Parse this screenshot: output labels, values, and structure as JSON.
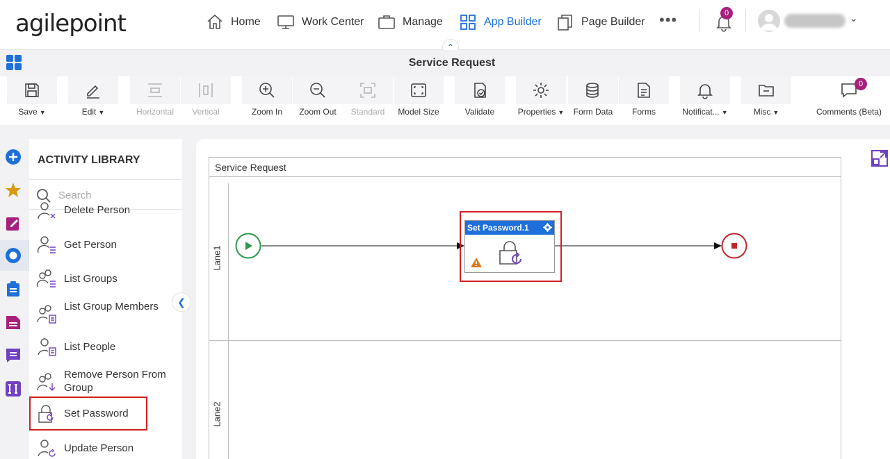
{
  "nav": {
    "logo": "agilepoint",
    "items": [
      {
        "label": "Home"
      },
      {
        "label": "Work Center"
      },
      {
        "label": "Manage"
      },
      {
        "label": "App Builder"
      },
      {
        "label": "Page Builder"
      }
    ],
    "notification_count": "0"
  },
  "page": {
    "title": "Service Request"
  },
  "toolbar": {
    "items": [
      {
        "label": "Save"
      },
      {
        "label": "Edit"
      },
      {
        "label": "Horizontal"
      },
      {
        "label": "Vertical"
      },
      {
        "label": "Zoom In"
      },
      {
        "label": "Zoom Out"
      },
      {
        "label": "Standard"
      },
      {
        "label": "Model Size"
      },
      {
        "label": "Validate"
      },
      {
        "label": "Properties"
      },
      {
        "label": "Form Data"
      },
      {
        "label": "Forms"
      },
      {
        "label": "Notificat..."
      },
      {
        "label": "Misc"
      },
      {
        "label": "Comments (Beta)"
      }
    ],
    "comments_count": "0"
  },
  "library": {
    "title": "ACTIVITY LIBRARY",
    "search_placeholder": "Search",
    "items": [
      {
        "label": "Delete Person"
      },
      {
        "label": "Get Person"
      },
      {
        "label": "List Groups"
      },
      {
        "label": "List Group Members"
      },
      {
        "label": "List People"
      },
      {
        "label": "Remove Person From Group"
      },
      {
        "label": "Set Password"
      },
      {
        "label": "Update Person"
      }
    ]
  },
  "canvas": {
    "pool_title": "Service Request",
    "lanes": [
      {
        "label": "Lane1"
      },
      {
        "label": "Lane2"
      }
    ],
    "activity": {
      "title": "Set Password.1"
    }
  },
  "colors": {
    "accent": "#1e6fd9",
    "highlight": "#d32024",
    "badge": "#a8207c",
    "start": "#2e9a4a",
    "end": "#c0262c"
  }
}
